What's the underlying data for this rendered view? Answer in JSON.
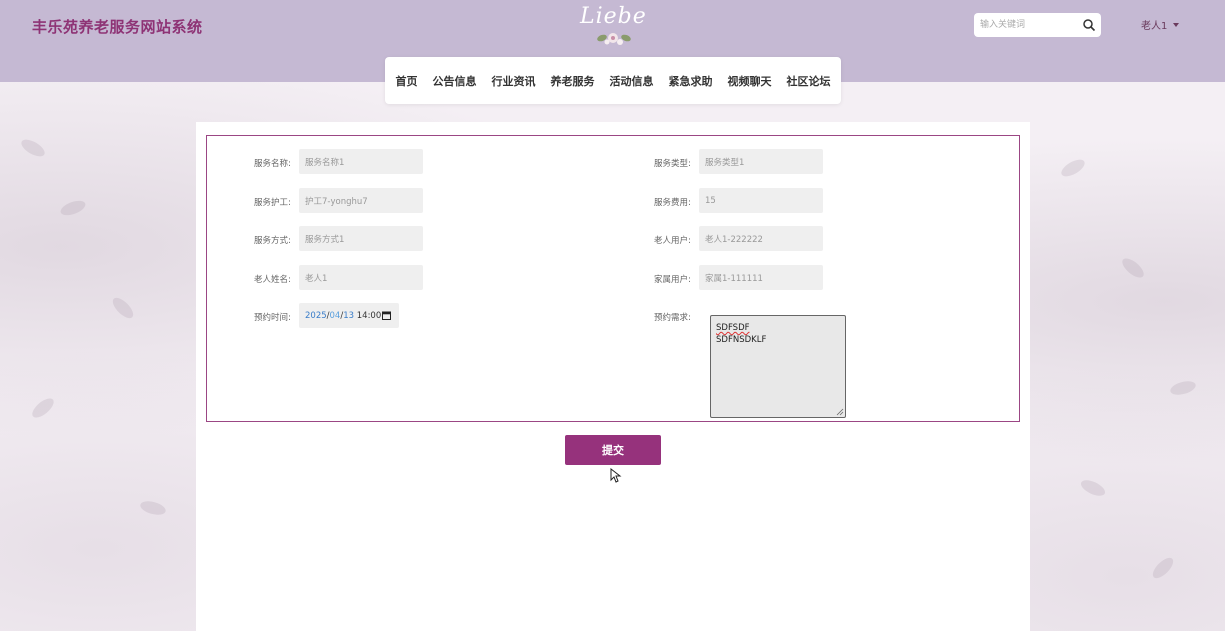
{
  "header": {
    "site_title": "丰乐苑养老服务网站系统",
    "logo_text": "Liebe",
    "search_placeholder": "输入关键词",
    "user_name": "老人1"
  },
  "nav": {
    "items": [
      {
        "label": "首页"
      },
      {
        "label": "公告信息"
      },
      {
        "label": "行业资讯"
      },
      {
        "label": "养老服务"
      },
      {
        "label": "活动信息"
      },
      {
        "label": "紧急求助"
      },
      {
        "label": "视频聊天"
      },
      {
        "label": "社区论坛"
      }
    ]
  },
  "form": {
    "service_name": {
      "label": "服务名称:",
      "value": "服务名称1"
    },
    "service_type": {
      "label": "服务类型:",
      "value": "服务类型1"
    },
    "service_nurse": {
      "label": "服务护工:",
      "value": "护工7-yonghu7"
    },
    "service_fee": {
      "label": "服务费用:",
      "value": "15"
    },
    "service_method": {
      "label": "服务方式:",
      "value": "服务方式1"
    },
    "elder_user": {
      "label": "老人用户:",
      "value": "老人1-222222"
    },
    "elder_name": {
      "label": "老人姓名:",
      "value": "老人1"
    },
    "family_user": {
      "label": "家属用户:",
      "value": "家属1-111111"
    },
    "appointment_time": {
      "label": "预约时间:",
      "year": "2025",
      "sep1": "/",
      "month": "04",
      "sep2": "/",
      "day": "13",
      "time": " 14:00"
    },
    "appointment_needs": {
      "label": "预约需求:",
      "line1": "SDFSDF",
      "line2": "SDFNSDKLF"
    },
    "submit_label": "提交"
  },
  "colors": {
    "header_bg": "#c5b9d3",
    "brand_title": "#8e3375",
    "accent_button": "#96327c",
    "frame_border": "#9b4684"
  }
}
